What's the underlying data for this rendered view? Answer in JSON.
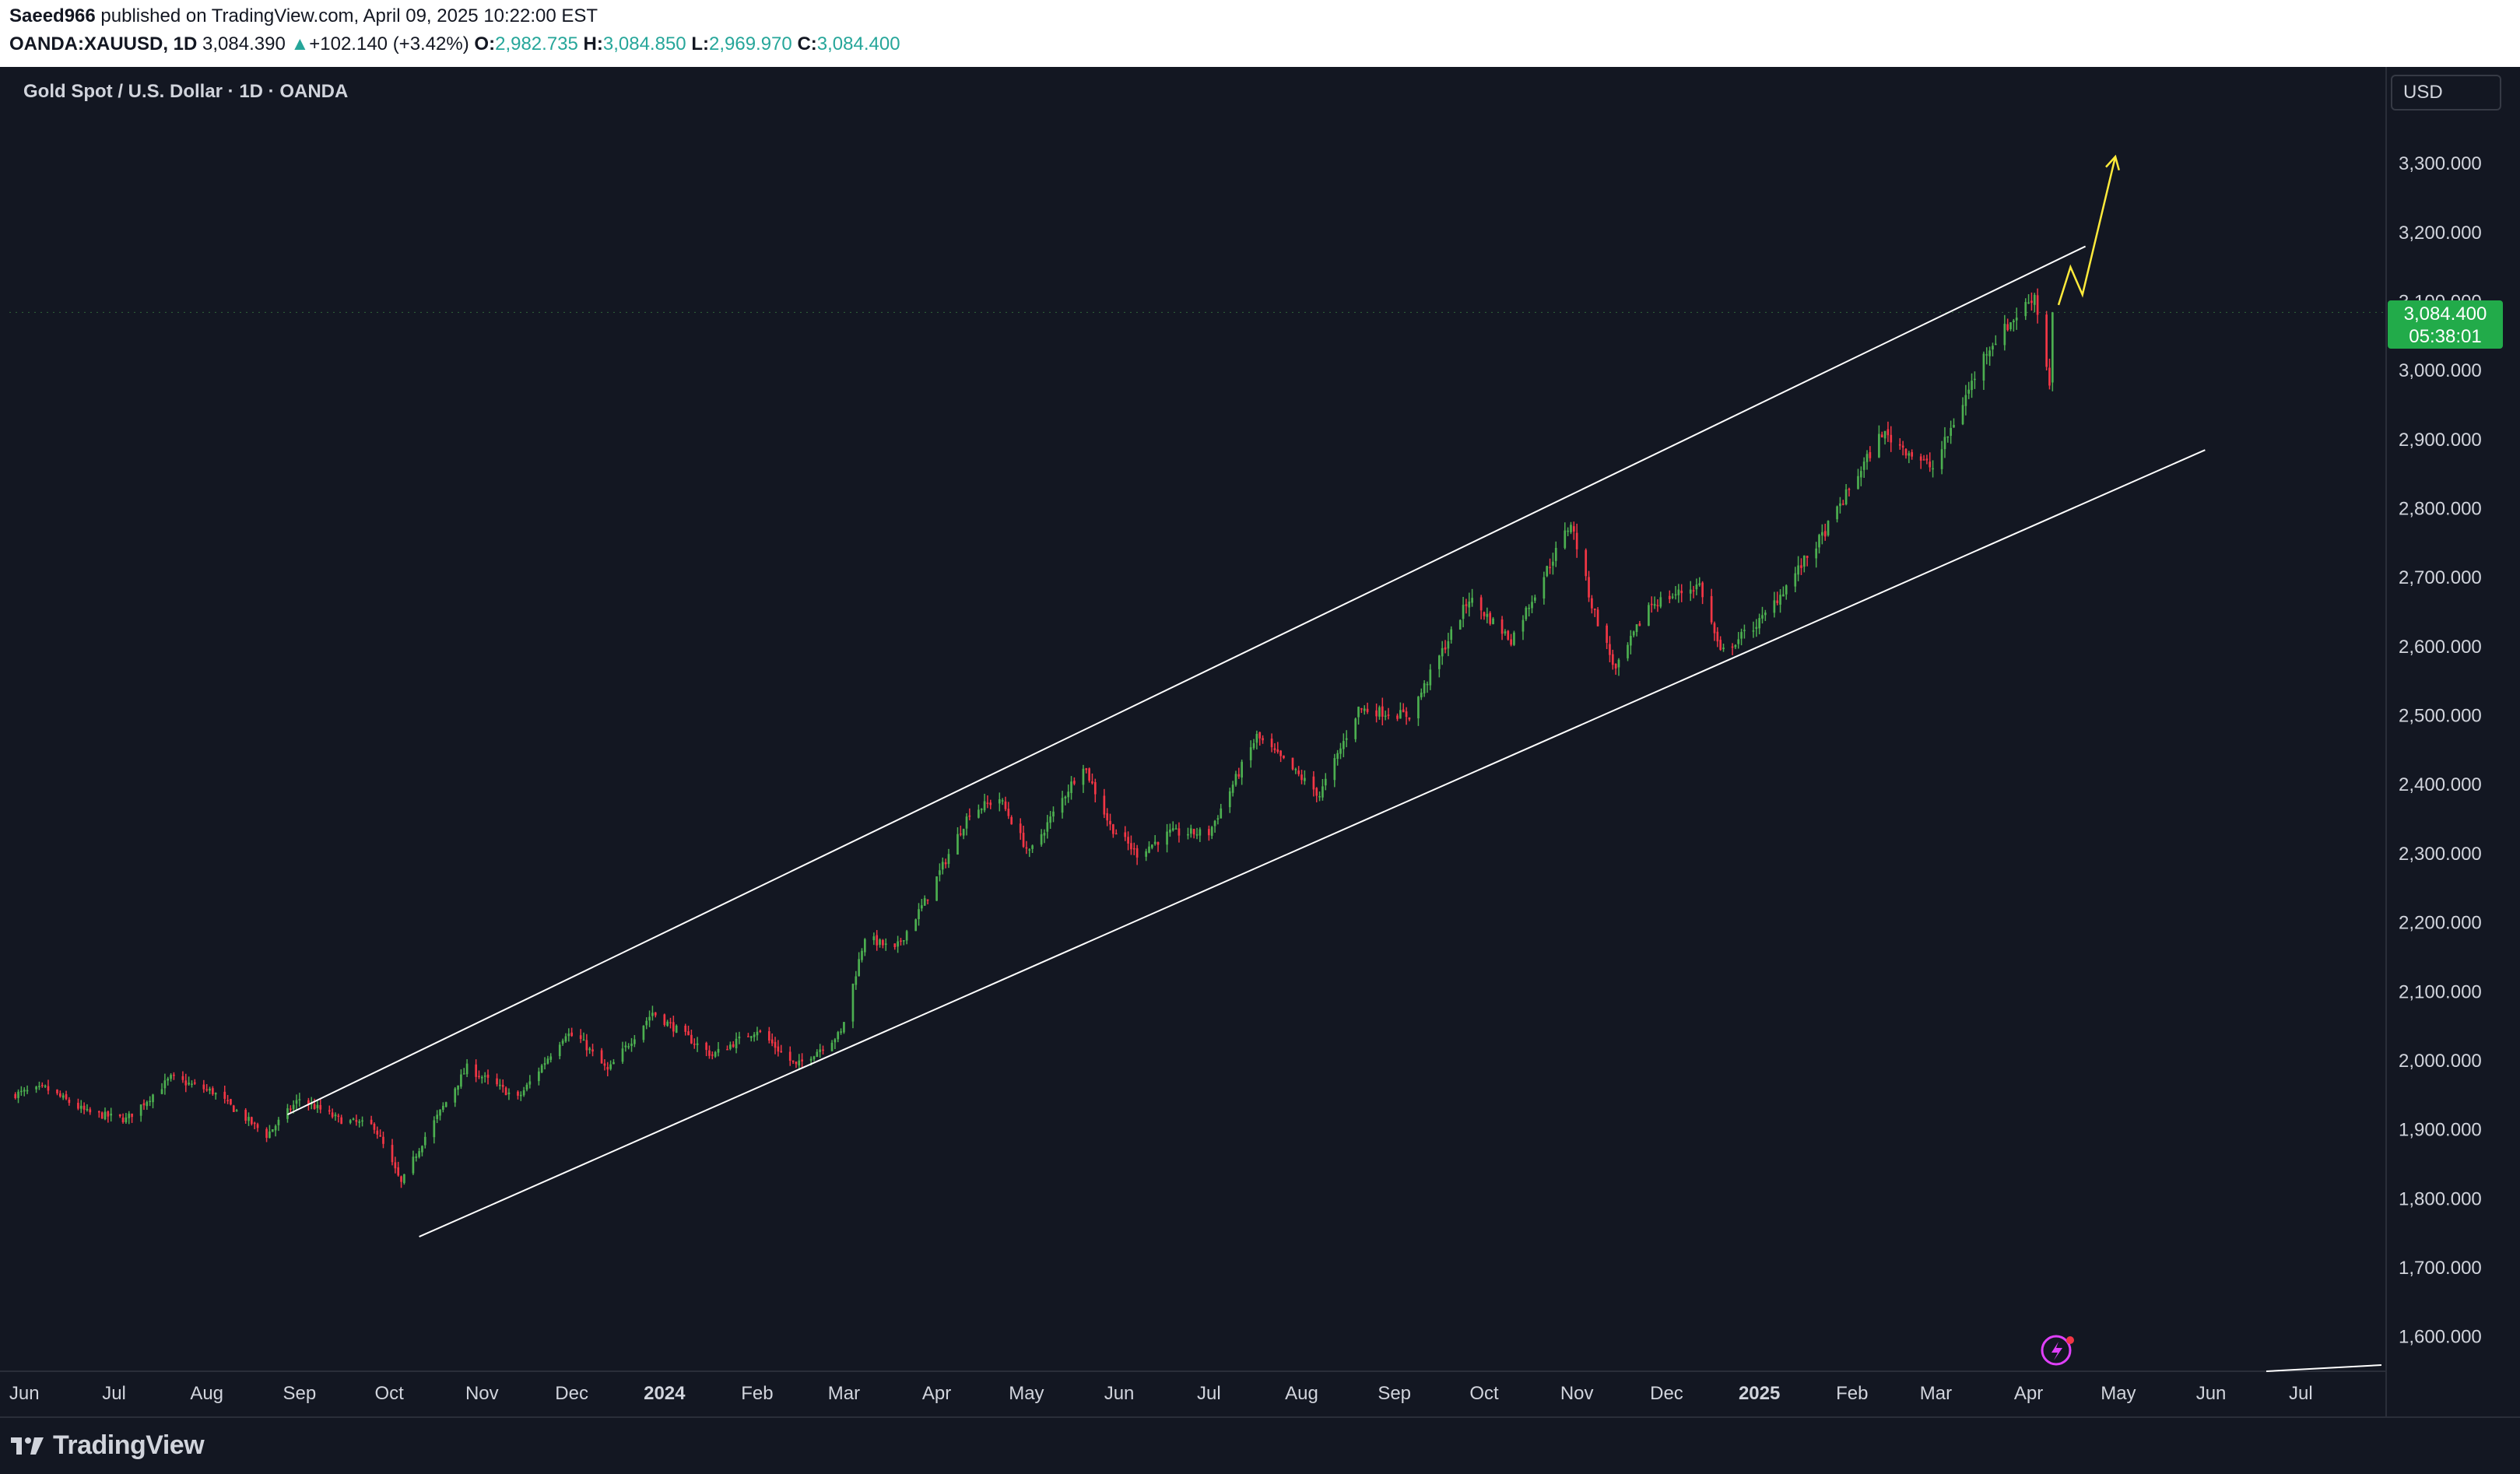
{
  "header": {
    "publisher": "Saeed966",
    "published_text": " published on TradingView.com, April 09, 2025 10:22:00 EST",
    "symbol": "OANDA:XAUUSD, 1D",
    "last": "3,084.390",
    "change_arrow": "▲",
    "change": "+102.140 (+3.42%)",
    "o_label": "O:",
    "o_value": "2,982.735",
    "h_label": "H:",
    "h_value": "3,084.850",
    "l_label": "L:",
    "l_value": "2,969.970",
    "c_label": "C:",
    "c_value": "3,084.400"
  },
  "chart_title": "Gold Spot / U.S. Dollar · 1D · OANDA",
  "currency_button": "USD",
  "price_label": {
    "price": "3,084.400",
    "countdown": "05:38:01"
  },
  "footer": {
    "brand": "TradingView"
  },
  "colors": {
    "background": "#131722",
    "up": "#4caf50",
    "down": "#f23645",
    "grid": "#1e222d",
    "axis_text": "#d1d4dc",
    "channel": "#ffffff",
    "projection": "#ffeb3b"
  },
  "chart_data": {
    "type": "candlestick",
    "title": "Gold Spot / U.S. Dollar · 1D · OANDA",
    "ylim": [
      1550,
      3440
    ],
    "y_ticks": [
      "1,600.000",
      "1,700.000",
      "1,800.000",
      "1,900.000",
      "2,000.000",
      "2,100.000",
      "2,200.000",
      "2,300.000",
      "2,400.000",
      "2,500.000",
      "2,600.000",
      "2,700.000",
      "2,800.000",
      "2,900.000",
      "3,000.000",
      "3,100.000",
      "3,200.000",
      "3,300.000"
    ],
    "x_ticks": [
      {
        "label": "Jun",
        "date": "2023-06-01",
        "bold": false
      },
      {
        "label": "Jul",
        "date": "2023-07-01",
        "bold": false
      },
      {
        "label": "Aug",
        "date": "2023-08-01",
        "bold": false
      },
      {
        "label": "Sep",
        "date": "2023-09-01",
        "bold": false
      },
      {
        "label": "Oct",
        "date": "2023-10-01",
        "bold": false
      },
      {
        "label": "Nov",
        "date": "2023-11-01",
        "bold": false
      },
      {
        "label": "Dec",
        "date": "2023-12-01",
        "bold": false
      },
      {
        "label": "2024",
        "date": "2024-01-01",
        "bold": true
      },
      {
        "label": "Feb",
        "date": "2024-02-01",
        "bold": false
      },
      {
        "label": "Mar",
        "date": "2024-03-01",
        "bold": false
      },
      {
        "label": "Apr",
        "date": "2024-04-01",
        "bold": false
      },
      {
        "label": "May",
        "date": "2024-05-01",
        "bold": false
      },
      {
        "label": "Jun",
        "date": "2024-06-01",
        "bold": false
      },
      {
        "label": "Jul",
        "date": "2024-07-01",
        "bold": false
      },
      {
        "label": "Aug",
        "date": "2024-08-01",
        "bold": false
      },
      {
        "label": "Sep",
        "date": "2024-09-01",
        "bold": false
      },
      {
        "label": "Oct",
        "date": "2024-10-01",
        "bold": false
      },
      {
        "label": "Nov",
        "date": "2024-11-01",
        "bold": false
      },
      {
        "label": "Dec",
        "date": "2024-12-01",
        "bold": false
      },
      {
        "label": "2025",
        "date": "2025-01-01",
        "bold": true
      },
      {
        "label": "Feb",
        "date": "2025-02-01",
        "bold": false
      },
      {
        "label": "Mar",
        "date": "2025-03-01",
        "bold": false
      },
      {
        "label": "Apr",
        "date": "2025-04-01",
        "bold": false
      },
      {
        "label": "May",
        "date": "2025-05-01",
        "bold": false
      },
      {
        "label": "Jun",
        "date": "2025-06-01",
        "bold": false
      },
      {
        "label": "Jul",
        "date": "2025-07-01",
        "bold": false
      }
    ],
    "x_range": [
      "2023-05-27",
      "2025-07-29"
    ],
    "price_path": [
      [
        "2023-05-27",
        1950
      ],
      [
        "2023-06-08",
        1960
      ],
      [
        "2023-06-22",
        1925
      ],
      [
        "2023-07-05",
        1915
      ],
      [
        "2023-07-20",
        1975
      ],
      [
        "2023-08-03",
        1955
      ],
      [
        "2023-08-21",
        1892
      ],
      [
        "2023-09-01",
        1945
      ],
      [
        "2023-09-14",
        1915
      ],
      [
        "2023-09-26",
        1905
      ],
      [
        "2023-10-05",
        1822
      ],
      [
        "2023-10-13",
        1890
      ],
      [
        "2023-10-27",
        1990
      ],
      [
        "2023-11-13",
        1945
      ],
      [
        "2023-11-29",
        2040
      ],
      [
        "2023-12-04",
        2030
      ],
      [
        "2023-12-13",
        1985
      ],
      [
        "2023-12-28",
        2070
      ],
      [
        "2024-01-17",
        2008
      ],
      [
        "2024-02-01",
        2045
      ],
      [
        "2024-02-14",
        1992
      ],
      [
        "2024-02-29",
        2040
      ],
      [
        "2024-03-08",
        2180
      ],
      [
        "2024-03-18",
        2160
      ],
      [
        "2024-03-28",
        2230
      ],
      [
        "2024-04-12",
        2360
      ],
      [
        "2024-04-22",
        2380
      ],
      [
        "2024-05-02",
        2300
      ],
      [
        "2024-05-20",
        2430
      ],
      [
        "2024-05-29",
        2340
      ],
      [
        "2024-06-07",
        2300
      ],
      [
        "2024-06-18",
        2330
      ],
      [
        "2024-07-01",
        2330
      ],
      [
        "2024-07-17",
        2470
      ],
      [
        "2024-08-07",
        2385
      ],
      [
        "2024-08-20",
        2510
      ],
      [
        "2024-09-06",
        2500
      ],
      [
        "2024-09-26",
        2670
      ],
      [
        "2024-10-10",
        2610
      ],
      [
        "2024-10-30",
        2780
      ],
      [
        "2024-11-06",
        2660
      ],
      [
        "2024-11-14",
        2565
      ],
      [
        "2024-11-25",
        2660
      ],
      [
        "2024-12-12",
        2690
      ],
      [
        "2024-12-19",
        2590
      ],
      [
        "2025-01-02",
        2640
      ],
      [
        "2025-01-22",
        2760
      ],
      [
        "2025-02-11",
        2910
      ],
      [
        "2025-02-28",
        2858
      ],
      [
        "2025-03-18",
        3030
      ],
      [
        "2025-03-28",
        3080
      ],
      [
        "2025-04-03",
        3110
      ],
      [
        "2025-04-08",
        2982
      ],
      [
        "2025-04-09",
        3084.4
      ]
    ],
    "channel_upper": [
      [
        "2023-08-28",
        1922
      ],
      [
        "2025-04-20",
        3180
      ]
    ],
    "channel_lower": [
      [
        "2023-10-11",
        1745
      ],
      [
        "2025-05-30",
        2885
      ]
    ],
    "projection": [
      [
        "2025-04-11",
        3095
      ],
      [
        "2025-04-15",
        3150
      ],
      [
        "2025-04-19",
        3110
      ],
      [
        "2025-04-30",
        3310
      ]
    ],
    "last_price": 3084.4,
    "grid": false
  }
}
